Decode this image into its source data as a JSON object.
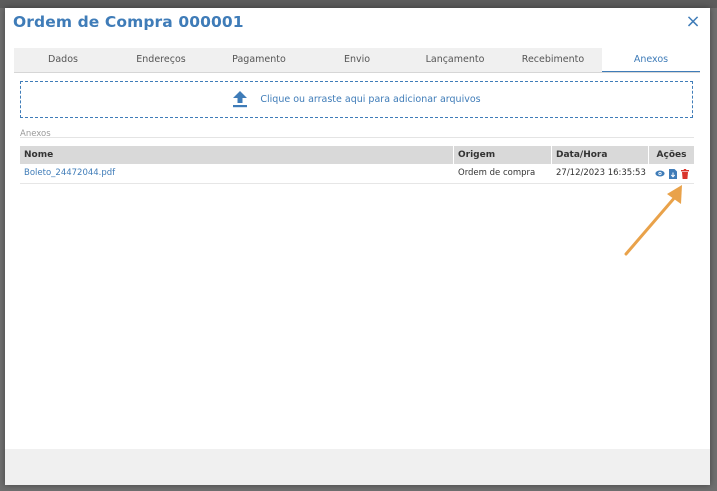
{
  "dialog": {
    "title": "Ordem de Compra 000001",
    "close_glyph": "×"
  },
  "tabs": [
    {
      "label": "Dados",
      "active": false
    },
    {
      "label": "Endereços",
      "active": false
    },
    {
      "label": "Pagamento",
      "active": false
    },
    {
      "label": "Envio",
      "active": false
    },
    {
      "label": "Lançamento",
      "active": false
    },
    {
      "label": "Recebimento",
      "active": false
    },
    {
      "label": "Anexos",
      "active": true
    }
  ],
  "dropzone": {
    "icon": "upload-icon",
    "text": "Clique ou arraste aqui para adicionar arquivos"
  },
  "attachments": {
    "section_label": "Anexos",
    "columns": {
      "name": "Nome",
      "origin": "Origem",
      "datetime": "Data/Hora",
      "actions": "Ações"
    },
    "rows": [
      {
        "name": "Boleto_24472044.pdf",
        "origin": "Ordem de compra",
        "datetime": "27/12/2023 16:35:53",
        "actions": [
          "view-icon",
          "download-icon",
          "delete-icon"
        ]
      }
    ]
  },
  "colors": {
    "accent": "#3f7cb8",
    "delete": "#d9342b",
    "annotation_arrow": "#e9a24a"
  }
}
